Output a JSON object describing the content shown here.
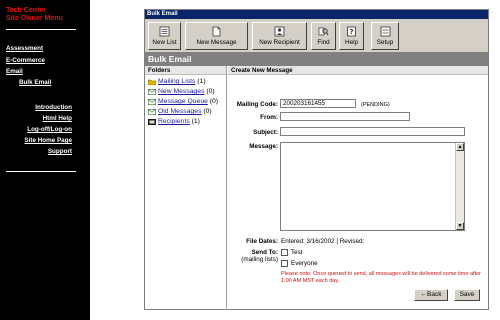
{
  "sidebar": {
    "title_line1": "Tech Center",
    "title_line2": "Site Owner Menu",
    "nav": [
      {
        "label": "Assessment"
      },
      {
        "label": "E-Commerce"
      },
      {
        "label": "Email"
      },
      {
        "label": "Bulk Email"
      }
    ],
    "links": [
      {
        "label": "Introduction"
      },
      {
        "label": "Html Help"
      },
      {
        "label": "Log-off/Log-on"
      },
      {
        "label": "Site Home Page"
      },
      {
        "label": "Support"
      }
    ]
  },
  "window": {
    "title": "Bulk Email",
    "heading": "Bulk Email"
  },
  "toolbar": {
    "buttons": [
      {
        "label": "New List",
        "icon": "list-icon"
      },
      {
        "label": "New Message",
        "icon": "new-message-icon"
      },
      {
        "label": "New Recipient",
        "icon": "recipient-icon"
      },
      {
        "label": "Find",
        "icon": "find-icon"
      },
      {
        "label": "Help",
        "icon": "help-icon"
      },
      {
        "label": "Setup",
        "icon": "setup-icon"
      }
    ]
  },
  "folders": {
    "header": "Folders",
    "items": [
      {
        "label": "Mailing Lists",
        "count": "(1)",
        "icon": "mailing-lists-icon"
      },
      {
        "label": "New Messages",
        "count": "(0)",
        "icon": "envelope-icon"
      },
      {
        "label": "Message Queue",
        "count": "(0)",
        "icon": "envelope-icon"
      },
      {
        "label": "Old Messages",
        "count": "(0)",
        "icon": "envelope-icon"
      },
      {
        "label": "Recipients",
        "count": "(1)",
        "icon": "recipients-icon"
      }
    ]
  },
  "create": {
    "header": "Create New Message",
    "mailing_code_label": "Mailing Code:",
    "mailing_code_value": "200203161455",
    "pending": "(PENDING)",
    "from_label": "From:",
    "from_value": "",
    "subject_label": "Subject:",
    "subject_value": "",
    "message_label": "Message:",
    "message_value": "",
    "file_dates_label": "File Dates:",
    "file_dates_value": "Entered: 3/16/2002  |  Revised:",
    "send_to_label": "Send To:",
    "send_to_sub": "(mailing lists)",
    "options": [
      {
        "label": "Test",
        "checked": false
      },
      {
        "label": "Everyone",
        "checked": false
      }
    ],
    "note": "Please note: Once queued to send, all messages will be delivered some time after 1:00 AM MST each day.",
    "back_label": "←Back",
    "save_label": "Save"
  },
  "colors": {
    "sidebar_bg": "#000000",
    "title_red": "#e01010",
    "titlebar_blue": "#0a246a",
    "toolbar_gray": "#d4d0c8",
    "heading_gray": "#808080",
    "link_blue": "#1a1a9a",
    "note_red": "#d01010"
  }
}
